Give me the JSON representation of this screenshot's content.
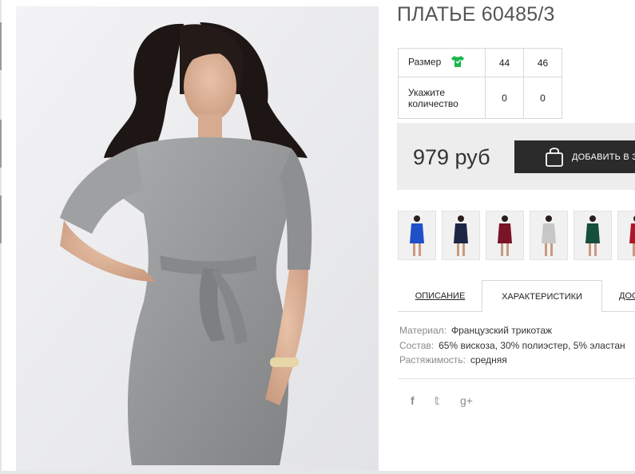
{
  "product": {
    "title": "ПЛАТЬЕ 60485/3",
    "main_image": "photo of model in grey melange dress with tie belt"
  },
  "size_table": {
    "size_label": "Размер",
    "size_icon": "green-tshirt-icon",
    "sizes": [
      "44",
      "46"
    ],
    "qty_label": "Укажите количество",
    "quantities": [
      "0",
      "0"
    ]
  },
  "purchase": {
    "price": "979 руб",
    "add_button_label": "ДОБАВИТЬ В ЗАКАЗ",
    "button_icon": "shopping-bag-icon"
  },
  "thumbnails": [
    {
      "color": "#1f4fc9",
      "alt": "blue"
    },
    {
      "color": "#1c2744",
      "alt": "navy"
    },
    {
      "color": "#7a1426",
      "alt": "burgundy"
    },
    {
      "color": "#c7c7c7",
      "alt": "grey"
    },
    {
      "color": "#15503a",
      "alt": "green"
    },
    {
      "color": "#b0162a",
      "alt": "red"
    }
  ],
  "tabs": {
    "items": [
      "ОПИСАНИЕ",
      "ХАРАКТЕРИСТИКИ",
      "ДОСТАВКА"
    ],
    "active": "ХАРАКТЕРИСТИКИ"
  },
  "specs": [
    {
      "key": "Материал:",
      "value": "Французский трикотаж"
    },
    {
      "key": "Состав:",
      "value": "65% вискоза, 30% полиэстер, 5% эластан"
    },
    {
      "key": "Растяжимость:",
      "value": "средняя"
    }
  ],
  "social": {
    "icons": [
      "facebook-icon",
      "twitter-icon",
      "google-plus-icon"
    ],
    "glyphs": [
      "f",
      "𝕥",
      "g+"
    ]
  },
  "colors": {
    "title": "#555555",
    "button_bg": "#2b2b2b",
    "price_bg": "#ededed",
    "size_icon_green": "#19b84c"
  }
}
